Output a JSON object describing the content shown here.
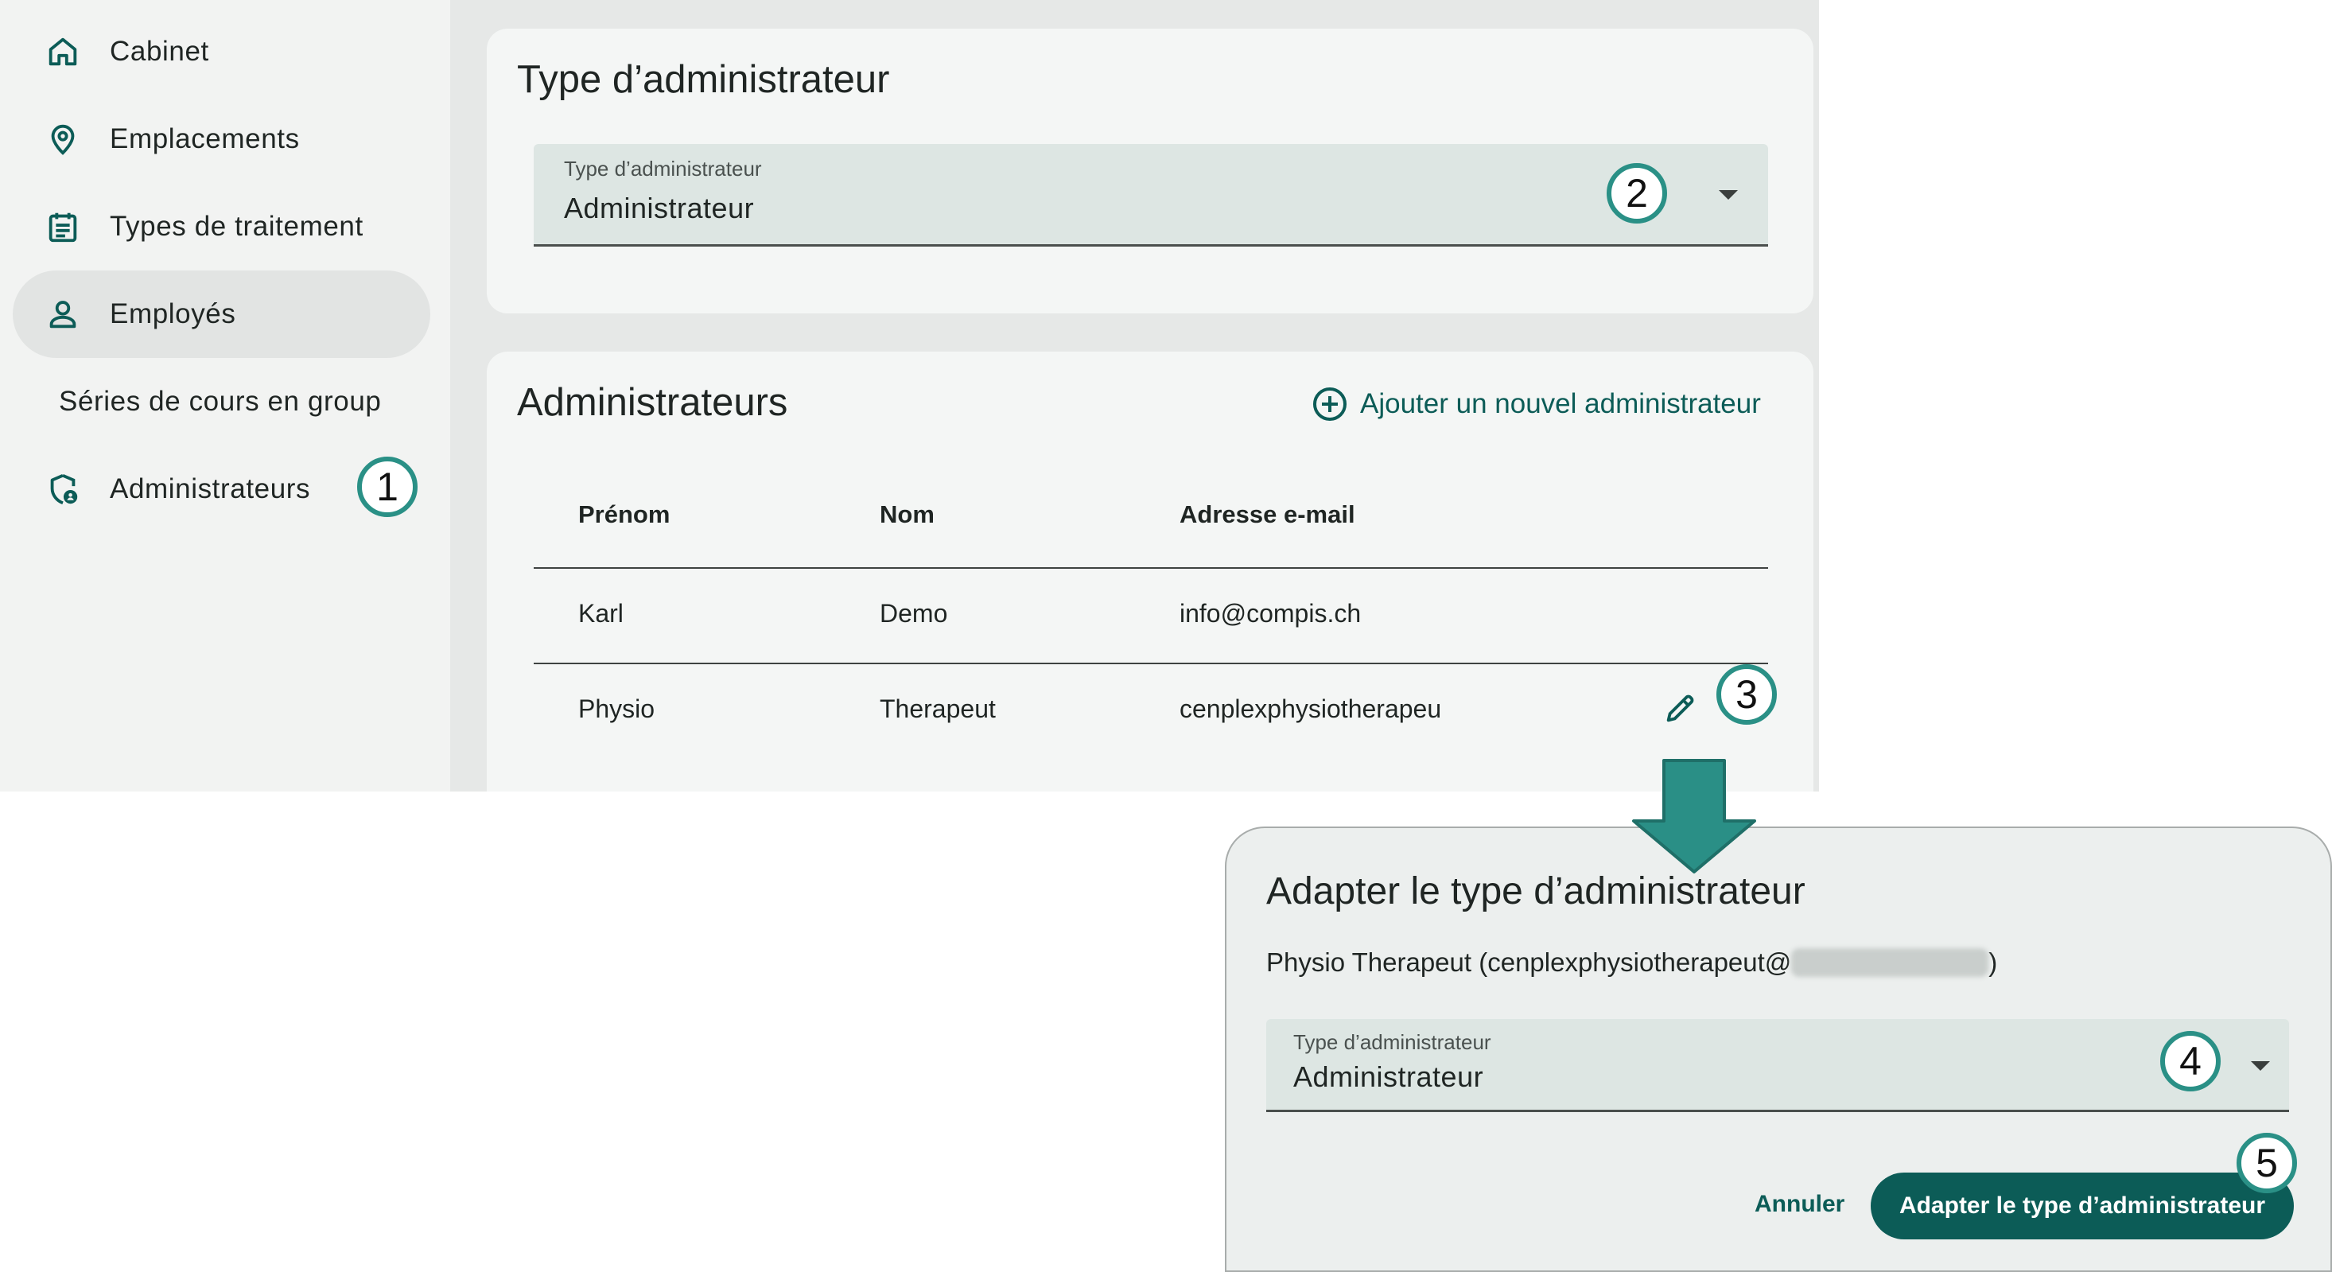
{
  "sidebar": {
    "items": [
      {
        "label": "Cabinet",
        "icon": "home-icon"
      },
      {
        "label": "Emplacements",
        "icon": "location-pin-icon"
      },
      {
        "label": "Types de traitement",
        "icon": "calendar-list-icon"
      },
      {
        "label": "Employés",
        "icon": "person-icon",
        "active": true
      },
      {
        "label": "Séries de cours en group",
        "icon": null
      },
      {
        "label": "Administrateurs",
        "icon": "shield-user-icon"
      }
    ]
  },
  "type_card": {
    "title": "Type d’administrateur",
    "select": {
      "label": "Type d’administrateur",
      "value": "Administrateur"
    }
  },
  "admins_card": {
    "title": "Administrateurs",
    "add_button": "Ajouter un nouvel administrateur",
    "columns": [
      "Prénom",
      "Nom",
      "Adresse e-mail"
    ],
    "rows": [
      {
        "first": "Karl",
        "last": "Demo",
        "email": "info@compis.ch"
      },
      {
        "first": "Physio",
        "last": "Therapeut",
        "email": "cenplexphysiotherapeu"
      }
    ]
  },
  "dialog": {
    "title": "Adapter le type d’administrateur",
    "subtitle_prefix": "Physio Therapeut (cenplexphysiotherapeut@",
    "subtitle_suffix": ")",
    "select": {
      "label": "Type d’administrateur",
      "value": "Administrateur"
    },
    "cancel": "Annuler",
    "confirm": "Adapter le type d’administrateur"
  },
  "callouts": [
    "1",
    "2",
    "3",
    "4",
    "5"
  ],
  "colors": {
    "accent": "#0c5c57",
    "callout_ring": "#2a9086",
    "arrow": "#2a8f86"
  }
}
